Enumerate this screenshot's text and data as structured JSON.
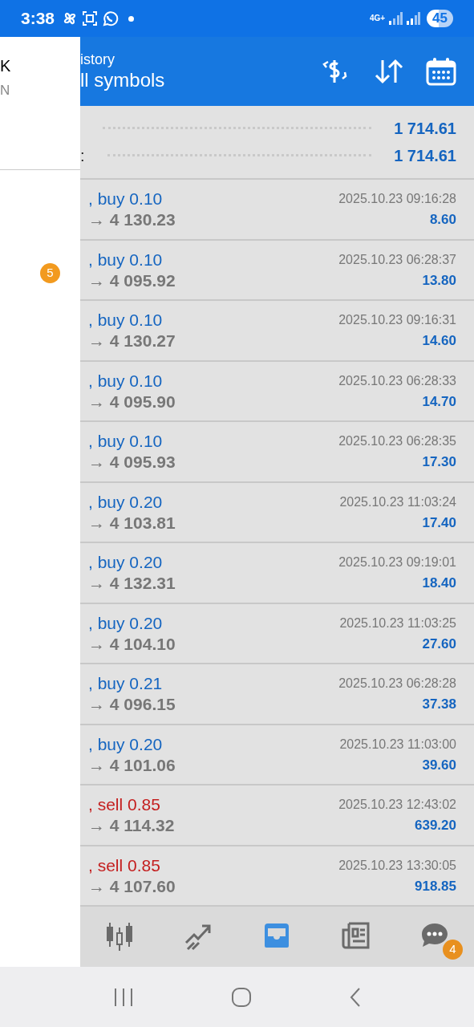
{
  "status_bar": {
    "time": "3:38",
    "network": "4G+",
    "battery": "45"
  },
  "drawer": {
    "line_1": "K",
    "line_2": "N",
    "badge": "5"
  },
  "header": {
    "title": "istory",
    "subtitle": "ll symbols"
  },
  "summary": [
    {
      "value": "1 714.61"
    },
    {
      "label": ":",
      "value": "1 714.61"
    }
  ],
  "deals": [
    {
      "kind": "buy",
      "type": ", buy 0.10",
      "prices": "→ 4 130.23",
      "time": "2025.10.23 09:16:28",
      "profit": "8.60"
    },
    {
      "kind": "buy",
      "type": ", buy 0.10",
      "prices": "→ 4 095.92",
      "time": "2025.10.23 06:28:37",
      "profit": "13.80"
    },
    {
      "kind": "buy",
      "type": ", buy 0.10",
      "prices": "→ 4 130.27",
      "time": "2025.10.23 09:16:31",
      "profit": "14.60"
    },
    {
      "kind": "buy",
      "type": ", buy 0.10",
      "prices": "→ 4 095.90",
      "time": "2025.10.23 06:28:33",
      "profit": "14.70"
    },
    {
      "kind": "buy",
      "type": ", buy 0.10",
      "prices": "→ 4 095.93",
      "time": "2025.10.23 06:28:35",
      "profit": "17.30"
    },
    {
      "kind": "buy",
      "type": ", buy 0.20",
      "prices": "→ 4 103.81",
      "time": "2025.10.23 11:03:24",
      "profit": "17.40"
    },
    {
      "kind": "buy",
      "type": ", buy 0.20",
      "prices": "→ 4 132.31",
      "time": "2025.10.23 09:19:01",
      "profit": "18.40"
    },
    {
      "kind": "buy",
      "type": ", buy 0.20",
      "prices": "→ 4 104.10",
      "time": "2025.10.23 11:03:25",
      "profit": "27.60"
    },
    {
      "kind": "buy",
      "type": ", buy 0.21",
      "prices": "→ 4 096.15",
      "time": "2025.10.23 06:28:28",
      "profit": "37.38"
    },
    {
      "kind": "buy",
      "type": ", buy 0.20",
      "prices": "→ 4 101.06",
      "time": "2025.10.23 11:03:00",
      "profit": "39.60"
    },
    {
      "kind": "sell",
      "type": ", sell 0.85",
      "prices": "→ 4 114.32",
      "time": "2025.10.23 12:43:02",
      "profit": "639.20"
    },
    {
      "kind": "sell",
      "type": ", sell 0.85",
      "prices": "→ 4 107.60",
      "time": "2025.10.23 13:30:05",
      "profit": "918.85"
    }
  ],
  "bottom_nav": [
    {
      "selected": false
    },
    {
      "selected": false
    },
    {
      "selected": true
    },
    {
      "selected": false
    },
    {
      "selected": false,
      "badge": "4"
    }
  ]
}
